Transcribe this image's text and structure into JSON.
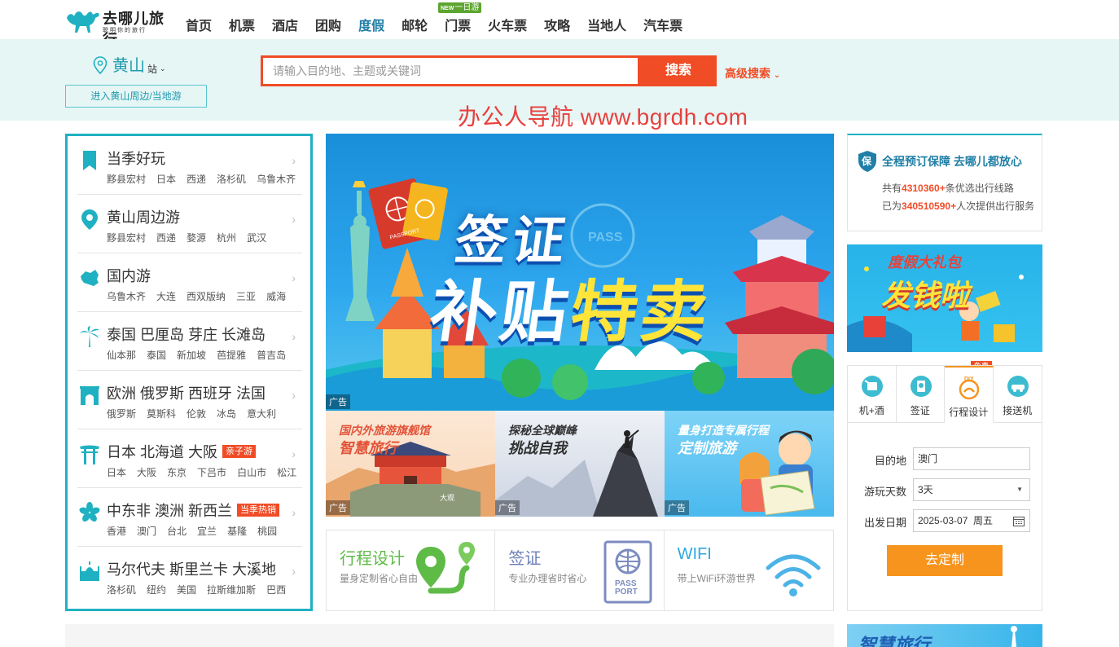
{
  "brand": {
    "name": "去哪儿旅行",
    "slogan": "聪明你的旅行"
  },
  "nav": {
    "items": [
      "首页",
      "机票",
      "酒店",
      "团购",
      "度假",
      "邮轮",
      "门票",
      "火车票",
      "攻略",
      "当地人",
      "汽车票"
    ],
    "active_index": 4,
    "badge_new": "NEW",
    "badge_text": "一日游"
  },
  "location": {
    "city": "黄山",
    "suffix": "站",
    "nearby_button": "进入黄山周边/当地游"
  },
  "search": {
    "placeholder": "请输入目的地、主题或关键词",
    "button": "搜索",
    "advanced": "高级搜索"
  },
  "watermark": "办公人导航  www.bgrdh.com",
  "left_menu": [
    {
      "icon": "bookmark-icon",
      "title": "当季好玩",
      "tag": "",
      "links": [
        "黟县宏村",
        "日本",
        "西递",
        "洛杉矶",
        "乌鲁木齐"
      ]
    },
    {
      "icon": "location-pin-icon",
      "title": "黄山周边游",
      "tag": "",
      "links": [
        "黟县宏村",
        "西递",
        "婺源",
        "杭州",
        "武汉"
      ]
    },
    {
      "icon": "china-map-icon",
      "title": "国内游",
      "tag": "",
      "links": [
        "乌鲁木齐",
        "大连",
        "西双版纳",
        "三亚",
        "威海"
      ]
    },
    {
      "icon": "palm-tree-icon",
      "title": "泰国 巴厘岛 芽庄 长滩岛",
      "tag": "",
      "links": [
        "仙本那",
        "泰国",
        "新加坡",
        "芭提雅",
        "普吉岛"
      ]
    },
    {
      "icon": "arch-icon",
      "title": "欧洲 俄罗斯 西班牙 法国",
      "tag": "",
      "links": [
        "俄罗斯",
        "莫斯科",
        "伦敦",
        "冰岛",
        "意大利"
      ]
    },
    {
      "icon": "torii-icon",
      "title": "日本 北海道 大阪",
      "tag": "亲子游",
      "links": [
        "日本",
        "大阪",
        "东京",
        "下吕市",
        "白山市",
        "松江"
      ]
    },
    {
      "icon": "bauhinia-icon",
      "title": "中东非 澳洲 新西兰",
      "tag": "当季热销",
      "links": [
        "香港",
        "澳门",
        "台北",
        "宜兰",
        "基隆",
        "桃园"
      ]
    },
    {
      "icon": "mosque-icon",
      "title": "马尔代夫 斯里兰卡 大溪地",
      "tag": "",
      "links": [
        "洛杉矶",
        "纽约",
        "美国",
        "拉斯维加斯",
        "巴西"
      ]
    }
  ],
  "banner": {
    "line1": "签证",
    "line2a": "补贴",
    "line2b": "特卖",
    "ad_label": "广告",
    "passport_text": "PASSPORT"
  },
  "sub_ads": [
    {
      "line1": "国内外旅游旗舰馆",
      "line2": "智慧旅行",
      "ad_label": "广告"
    },
    {
      "line1": "探秘全球巅峰",
      "line2": "挑战自我",
      "ad_label": "广告"
    },
    {
      "line1": "量身打造专属行程",
      "line2": "定制旅游",
      "ad_label": "广告"
    }
  ],
  "services": [
    {
      "title": "行程设计",
      "desc": "量身定制省心自由",
      "color": "#5dbb46"
    },
    {
      "title": "签证",
      "desc": "专业办理省时省心",
      "color": "#6c7fb8",
      "icon_text_1": "PASS",
      "icon_text_2": "PORT"
    },
    {
      "title": "WIFI",
      "desc": "带上WiFi环游世界",
      "color": "#2fa8e0"
    }
  ],
  "guarantee": {
    "icon_char": "保",
    "title": "全程预订保障 去哪儿都放心",
    "line1_pre": "共有",
    "line1_num": "4310360+",
    "line1_post": "条优选出行线路",
    "line2_pre": "已为",
    "line2_num": "340510590+",
    "line2_post": "人次提供出行服务"
  },
  "promo": {
    "line1": "度假大礼包",
    "line2": "发钱啦"
  },
  "planner": {
    "tabs": [
      {
        "icon": "hotel-flight-icon",
        "label": "机+酒"
      },
      {
        "icon": "visa-icon",
        "label": "签证"
      },
      {
        "icon": "diy-icon",
        "label": "行程设计",
        "icon_text": "DIY"
      },
      {
        "icon": "car-icon",
        "label": "接送机"
      }
    ],
    "active_index": 2,
    "free_badge": "免费",
    "destination_label": "目的地",
    "destination_value": "澳门",
    "days_label": "游玩天数",
    "days_value": "3天",
    "date_label": "出发日期",
    "date_value": "2025-03-07  周五",
    "submit": "去定制"
  },
  "bottom_ad": {
    "text": "智慧旅行"
  }
}
